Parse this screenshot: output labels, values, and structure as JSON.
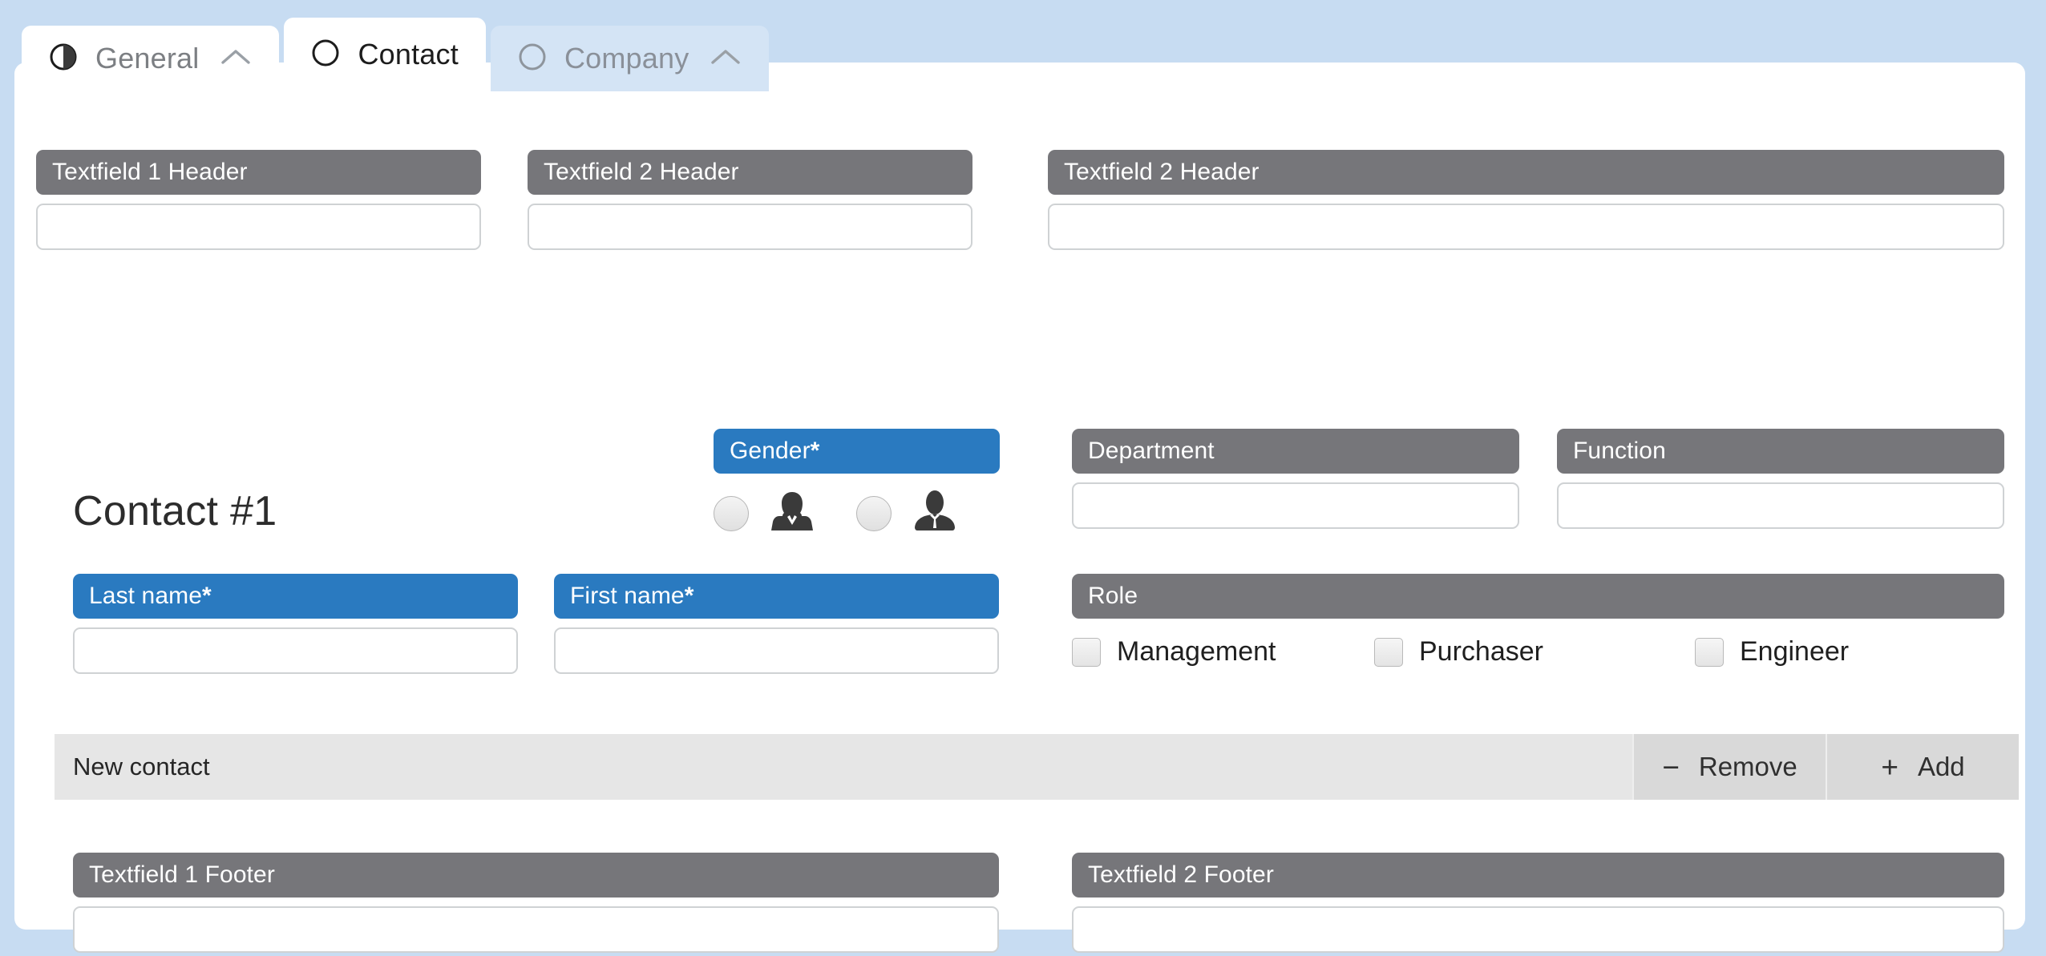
{
  "theme": {
    "page_background": "#c7dcf2",
    "panel_background": "#ffffff",
    "header_grey": "#76767a",
    "header_blue": "#2a7ac0",
    "bar_grey": "#e6e6e6",
    "button_grey": "#d9d9d9"
  },
  "tabs": [
    {
      "label": "General",
      "icon": "half-circle-icon",
      "chevron": "chevron-up-icon",
      "state": "available"
    },
    {
      "label": "Contact",
      "icon": "circle-icon",
      "chevron": "none",
      "state": "selected"
    },
    {
      "label": "Company",
      "icon": "circle-icon",
      "chevron": "chevron-up-icon",
      "state": "disabled"
    }
  ],
  "top_fields": [
    {
      "label": "Textfield 1 Header",
      "value": "",
      "placeholder": ""
    },
    {
      "label": "Textfield 2 Header",
      "value": "",
      "placeholder": ""
    },
    {
      "label": "Textfield 2 Header",
      "value": "",
      "placeholder": ""
    }
  ],
  "contact": {
    "title": "Contact #1",
    "gender": {
      "label": "Gender",
      "required_marker": "*",
      "options": [
        {
          "icon": "female-avatar-icon",
          "selected": false
        },
        {
          "icon": "male-avatar-icon",
          "selected": false
        }
      ]
    },
    "department": {
      "label": "Department",
      "value": "",
      "placeholder": ""
    },
    "function": {
      "label": "Function",
      "value": "",
      "placeholder": ""
    },
    "last_name": {
      "label": "Last name",
      "required_marker": "*",
      "value": "",
      "placeholder": ""
    },
    "first_name": {
      "label": "First name",
      "required_marker": "*",
      "value": "",
      "placeholder": ""
    },
    "role": {
      "label": "Role",
      "options": [
        {
          "label": "Management",
          "checked": false
        },
        {
          "label": "Purchaser",
          "checked": false
        },
        {
          "label": "Engineer",
          "checked": false
        }
      ]
    }
  },
  "contact_bar": {
    "label": "New contact",
    "remove_label": "Remove",
    "remove_glyph": "minus-icon",
    "add_label": "Add",
    "add_glyph": "plus-icon"
  },
  "footer_fields": [
    {
      "label": "Textfield 1 Footer",
      "value": "",
      "placeholder": ""
    },
    {
      "label": "Textfield 2 Footer",
      "value": "",
      "placeholder": ""
    }
  ]
}
